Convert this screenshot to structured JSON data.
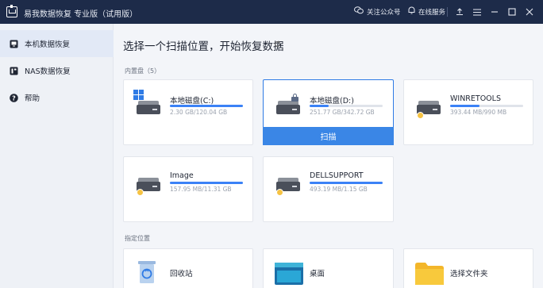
{
  "titlebar": {
    "title": "易我数据恢复 专业版（试用版）",
    "wechat_label": "关注公众号",
    "service_label": "在线服务",
    "icons": [
      "wechat-icon",
      "bell-icon",
      "upload-icon",
      "menu-icon",
      "minimize-icon",
      "maximize-icon",
      "close-icon"
    ]
  },
  "sidebar": {
    "items": [
      {
        "label": "本机数据恢复",
        "icon": "computer-icon",
        "active": true
      },
      {
        "label": "NAS数据恢复",
        "icon": "nas-icon",
        "active": false
      },
      {
        "label": "帮助",
        "icon": "help-icon",
        "active": false
      }
    ]
  },
  "main": {
    "title": "选择一个扫描位置，开始恢复数据",
    "builtin_label": "内置盘（5）",
    "location_label": "指定位置",
    "scan_label": "扫描",
    "disks": [
      {
        "name": "本地磁盘(C:)",
        "size": "2.30 GB/120.04 GB",
        "usage": 0.02,
        "system": true,
        "locked": false
      },
      {
        "name": "本地磁盘(D:)",
        "size": "251.77 GB/342.72 GB",
        "usage": 0.73,
        "system": false,
        "locked": true
      },
      {
        "name": "WINRETOOLS",
        "size": "393.44 MB/990 MB",
        "usage": 0.4,
        "system": false,
        "locked": false
      },
      {
        "name": "Image",
        "size": "157.95 MB/11.31 GB",
        "usage": 0.01,
        "system": false,
        "locked": false
      },
      {
        "name": "DELLSUPPORT",
        "size": "493.19 MB/1.15 GB",
        "usage": 0.43,
        "system": false,
        "locked": false
      }
    ],
    "locations": [
      {
        "name": "回收站",
        "icon": "recycle-bin-icon"
      },
      {
        "name": "桌面",
        "icon": "desktop-icon"
      },
      {
        "name": "选择文件夹",
        "icon": "folder-icon"
      }
    ]
  },
  "colors": {
    "accent": "#3a86e6",
    "titlebar": "#1d2b49"
  }
}
